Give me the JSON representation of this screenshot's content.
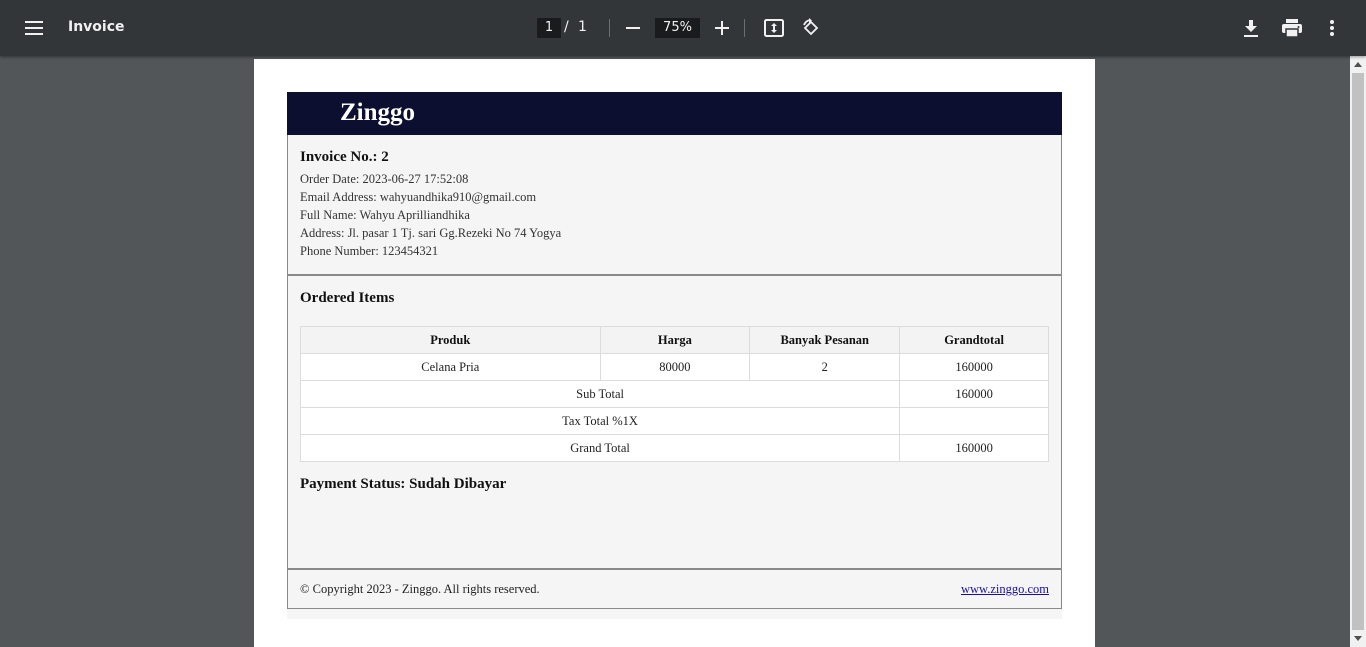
{
  "toolbar": {
    "title": "Invoice",
    "page_current": "1",
    "page_separator": "/",
    "page_total": "1",
    "zoom": "75%",
    "icons": {
      "menu": "menu-icon",
      "zoom_out": "minus-icon",
      "zoom_in": "plus-icon",
      "fit": "fit-page-icon",
      "rotate": "rotate-icon",
      "download": "download-icon",
      "print": "print-icon",
      "more": "more-vert-icon"
    }
  },
  "invoice": {
    "brand": "Zinggo",
    "invoice_no": "Invoice No.: 2",
    "order_date": "Order Date: 2023-06-27 17:52:08",
    "email": "Email Address: wahyuandhika910@gmail.com",
    "full_name": "Full Name: Wahyu Aprilliandhika",
    "address": "Address: Jl. pasar 1 Tj. sari Gg.Rezeki No 74 Yogya",
    "phone": "Phone Number: 123454321",
    "ordered_items_title": "Ordered Items",
    "table": {
      "headers": [
        "Produk",
        "Harga",
        "Banyak Pesanan",
        "Grandtotal"
      ],
      "rows": [
        [
          "Celana Pria",
          "80000",
          "2",
          "160000"
        ]
      ],
      "sub_total_label": "Sub Total",
      "sub_total_value": "160000",
      "tax_label": "Tax Total %1X",
      "tax_value": "",
      "grand_total_label": "Grand Total",
      "grand_total_value": "160000"
    },
    "payment_status": "Payment Status: Sudah Dibayar",
    "copyright": "© Copyright 2023 - Zinggo. All rights reserved.",
    "website": "www.zinggo.com"
  },
  "colors": {
    "toolbar_bg": "#323639",
    "viewer_bg": "#525659",
    "invoice_header_bg": "#0c0f2f",
    "invoice_body_bg": "#f5f5f5",
    "link": "#1a0dab"
  }
}
